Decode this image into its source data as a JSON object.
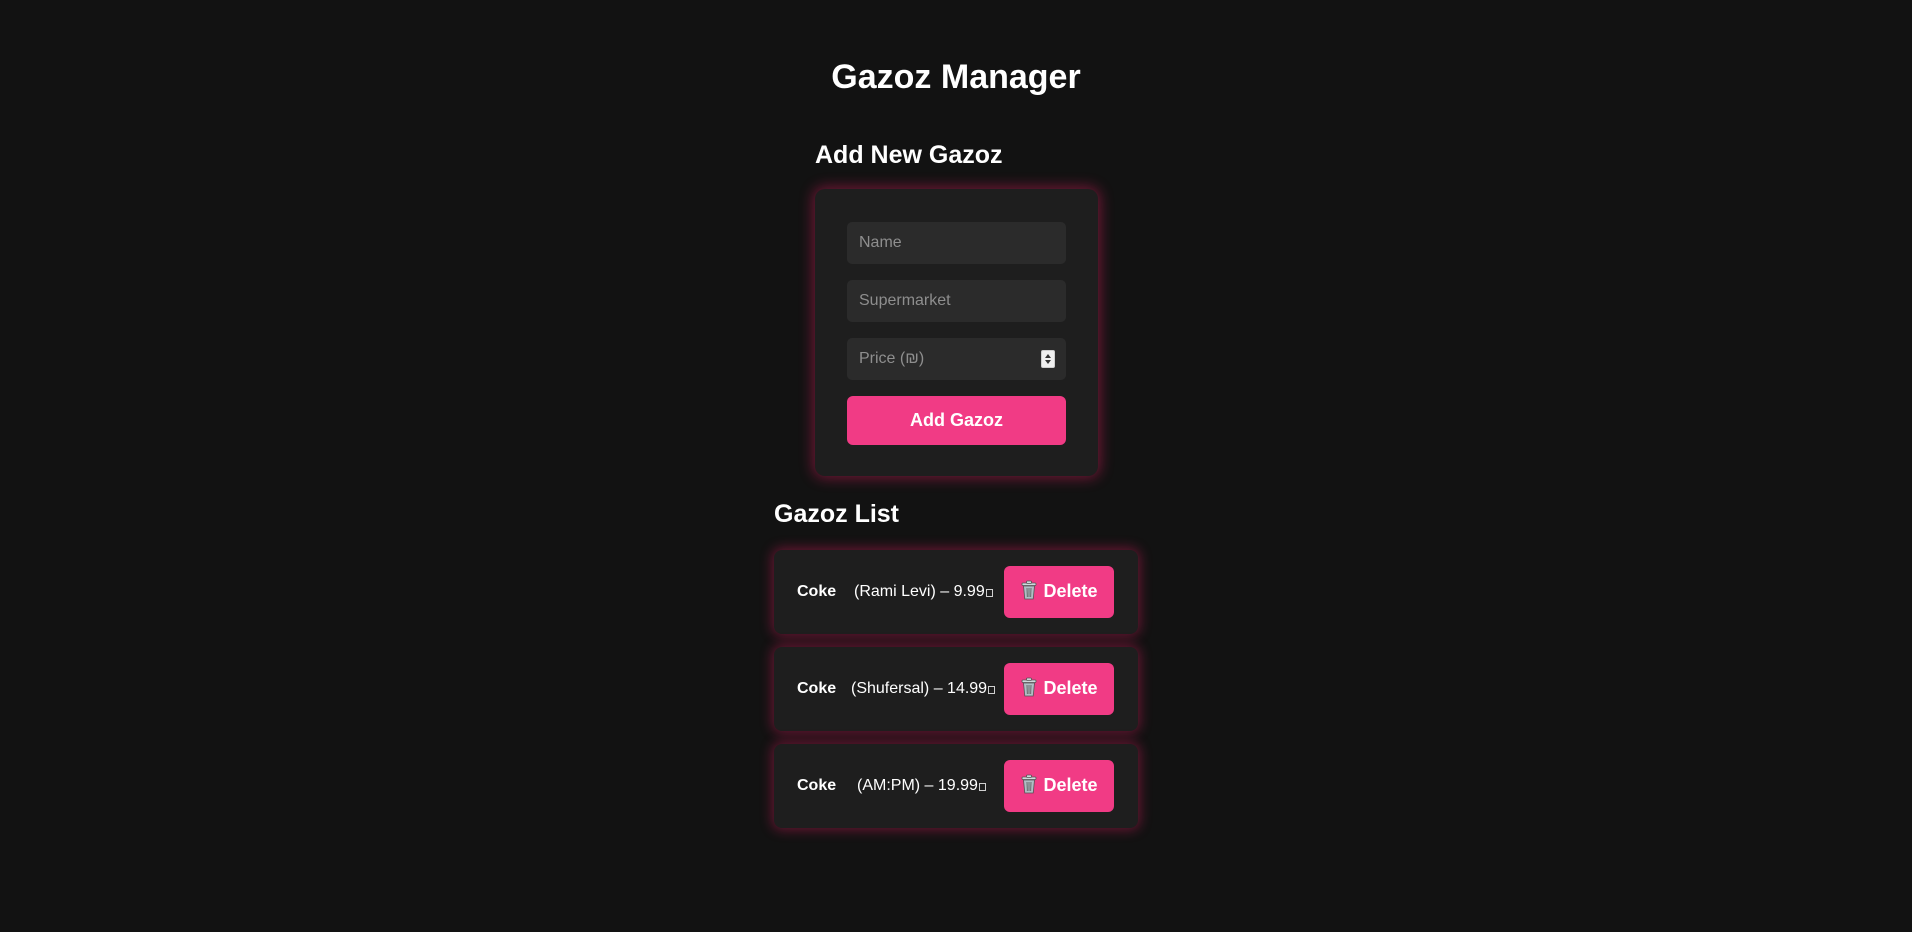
{
  "app": {
    "title": "Gazoz Manager"
  },
  "add_form": {
    "title": "Add New Gazoz",
    "name_placeholder": "Name",
    "supermarket_placeholder": "Supermarket",
    "price_placeholder": "Price (₪)",
    "submit_label": "Add Gazoz"
  },
  "list": {
    "title": "Gazoz List",
    "delete_label": "Delete",
    "delete_icon": "trash-icon",
    "items": [
      {
        "name": "Coke",
        "detail": "(Rami Levi) – 9.99"
      },
      {
        "name": "Coke",
        "detail": "(Shufersal) – 14.99"
      },
      {
        "name": "Coke",
        "detail": "(AM:PM) – 19.99"
      }
    ]
  },
  "colors": {
    "background": "#121212",
    "card": "#1e1e1e",
    "input": "#2b2b2b",
    "accent": "#f13b85",
    "glow": "#e91e63"
  }
}
